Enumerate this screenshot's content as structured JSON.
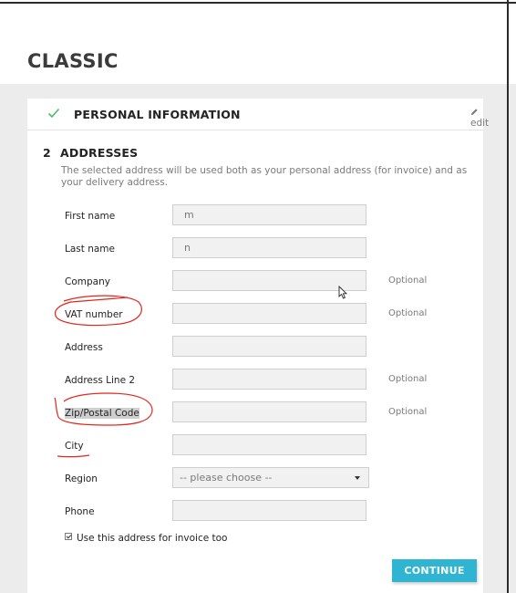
{
  "store": {
    "title": "CLASSIC"
  },
  "steps": {
    "personal": {
      "title": "PERSONAL INFORMATION",
      "edit_label": "edit"
    },
    "addresses": {
      "number": "2",
      "title": "ADDRESSES",
      "description": "The selected address will be used both as your personal address (for invoice) and as your delivery address."
    }
  },
  "form": {
    "first_name": {
      "label": "First name",
      "value": "m"
    },
    "last_name": {
      "label": "Last name",
      "value": "n"
    },
    "company": {
      "label": "Company",
      "value": "",
      "hint": "Optional"
    },
    "vat_number": {
      "label": "VAT number",
      "value": "",
      "hint": "Optional"
    },
    "address": {
      "label": "Address",
      "value": ""
    },
    "address2": {
      "label": "Address Line 2",
      "value": "",
      "hint": "Optional"
    },
    "zip": {
      "label": "Zip/Postal Code",
      "value": "",
      "hint": "Optional"
    },
    "city": {
      "label": "City",
      "value": ""
    },
    "region": {
      "label": "Region",
      "selected": "-- please choose --"
    },
    "phone": {
      "label": "Phone",
      "value": ""
    },
    "use_for_invoice": {
      "label": "Use this address for invoice too",
      "checked": true
    },
    "continue_label": "CONTINUE"
  },
  "colors": {
    "accent": "#2fb5d2",
    "check": "#4cbb6c",
    "annotation": "#e2271c"
  }
}
